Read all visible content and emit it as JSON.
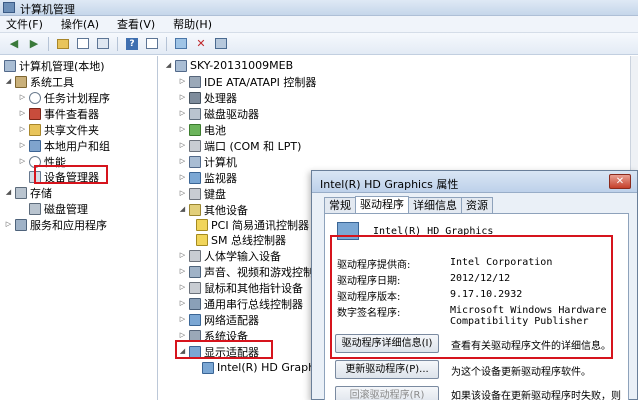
{
  "window": {
    "title": "计算机管理"
  },
  "menu": [
    "文件(F)",
    "操作(A)",
    "查看(V)",
    "帮助(H)"
  ],
  "left_tree": {
    "root": "计算机管理(本地)",
    "system_tools": "系统工具",
    "task_scheduler": "任务计划程序",
    "event_viewer": "事件查看器",
    "shared_folders": "共享文件夹",
    "local_users": "本地用户和组",
    "performance": "性能",
    "device_manager": "设备管理器",
    "storage": "存储",
    "disk_management": "磁盘管理",
    "services": "服务和应用程序"
  },
  "device_tree": {
    "computer": "SKY-20131009MEB",
    "items": [
      "IDE ATA/ATAPI 控制器",
      "处理器",
      "磁盘驱动器",
      "电池",
      "端口 (COM 和 LPT)",
      "计算机",
      "监视器",
      "键盘",
      "其他设备"
    ],
    "other_devices": [
      "PCI 简易通讯控制器",
      "SM 总线控制器"
    ],
    "items2": [
      "人体学输入设备",
      "声音、视频和游戏控制器",
      "鼠标和其他指针设备",
      "通用串行总线控制器",
      "网络适配器",
      "系统设备",
      "显示适配器"
    ],
    "display_child": "Intel(R) HD Graphics"
  },
  "dialog": {
    "title": "Intel(R) HD Graphics 属性",
    "close": "✕",
    "tabs": [
      "常规",
      "驱动程序",
      "详细信息",
      "资源"
    ],
    "device_name": "Intel(R) HD Graphics",
    "props": [
      {
        "label": "驱动程序提供商:",
        "value": "Intel Corporation"
      },
      {
        "label": "驱动程序日期:",
        "value": "2012/12/12"
      },
      {
        "label": "驱动程序版本:",
        "value": "9.17.10.2932"
      },
      {
        "label": "数字签名程序:",
        "value": "Microsoft Windows Hardware Compatibility Publisher"
      }
    ],
    "btn_details": "驱动程序详细信息(I)",
    "btn_details_desc": "查看有关驱动程序文件的详细信息。",
    "btn_update": "更新驱动程序(P)...",
    "btn_update_desc": "为这个设备更新驱动程序软件。",
    "btn_rollback": "回滚驱动程序(R)",
    "btn_rollback_desc": "如果该设备在更新驱动程序时失败，则"
  }
}
